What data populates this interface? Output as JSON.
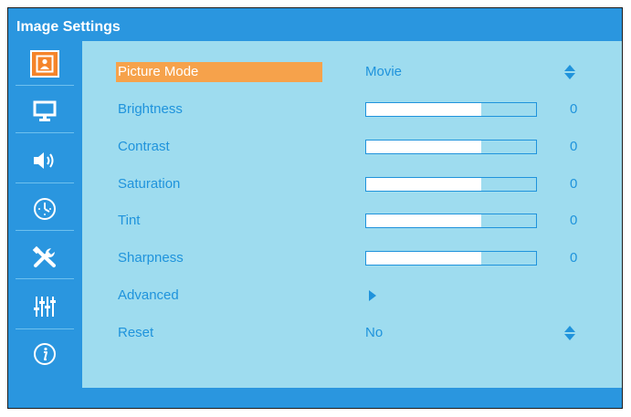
{
  "window": {
    "title": "Image Settings"
  },
  "sidebar": {
    "items": [
      {
        "icon": "picture-icon",
        "selected": true
      },
      {
        "icon": "monitor-icon",
        "selected": false
      },
      {
        "icon": "speaker-icon",
        "selected": false
      },
      {
        "icon": "clock-icon",
        "selected": false
      },
      {
        "icon": "tools-icon",
        "selected": false
      },
      {
        "icon": "equalizer-icon",
        "selected": false
      },
      {
        "icon": "info-icon",
        "selected": false
      }
    ]
  },
  "menu": {
    "picture_mode": {
      "label": "Picture Mode",
      "value": "Movie"
    },
    "brightness": {
      "label": "Brightness",
      "value": "0",
      "level": 0.68
    },
    "contrast": {
      "label": "Contrast",
      "value": "0",
      "level": 0.68
    },
    "saturation": {
      "label": "Saturation",
      "value": "0",
      "level": 0.68
    },
    "tint": {
      "label": "Tint",
      "value": "0",
      "level": 0.68
    },
    "sharpness": {
      "label": "Sharpness",
      "value": "0",
      "level": 0.68
    },
    "advanced": {
      "label": "Advanced"
    },
    "reset": {
      "label": "Reset",
      "value": "No"
    }
  },
  "colors": {
    "panel_bg": "#9edcef",
    "title_bar": "#2a96df",
    "highlight": "#f6a24b",
    "text": "#1f93dc"
  }
}
